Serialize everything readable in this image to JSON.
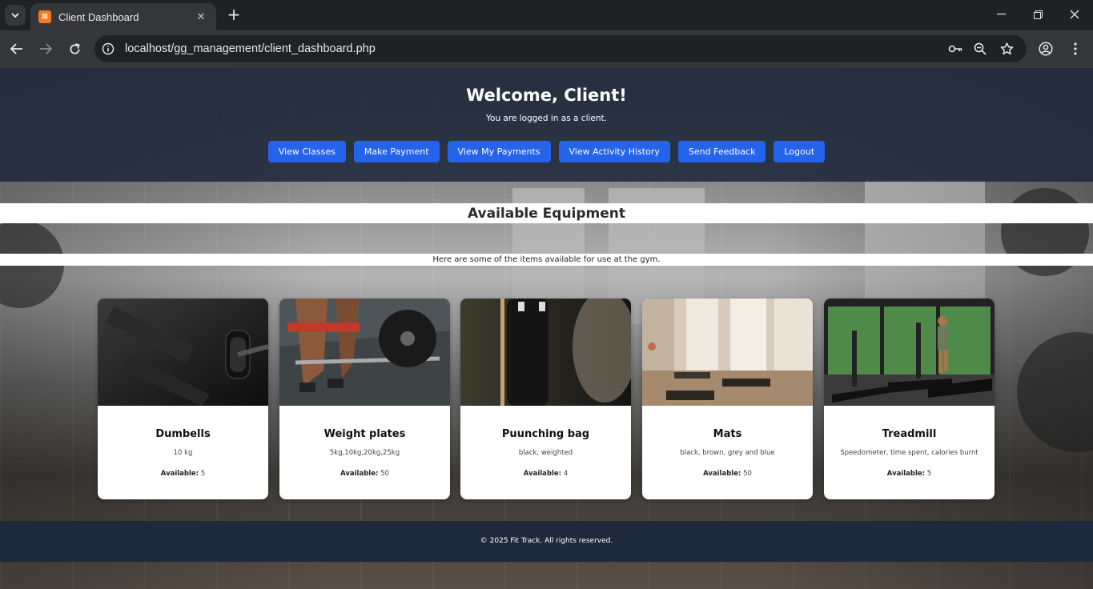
{
  "browser": {
    "tab_title": "Client Dashboard",
    "url": "localhost/gg_management/client_dashboard.php"
  },
  "header": {
    "title": "Welcome, Client!",
    "subtitle": "You are logged in as a client.",
    "nav": [
      "View Classes",
      "Make Payment",
      "View My Payments",
      "View Activity History",
      "Send Feedback",
      "Logout"
    ]
  },
  "equipment": {
    "title": "Available Equipment",
    "subtitle": "Here are some of the items available for use at the gym.",
    "available_label": "Available:",
    "items": [
      {
        "name": "Dumbells",
        "description": "10 kg",
        "available": "5"
      },
      {
        "name": "Weight plates",
        "description": "5kg,10kg,20kg,25kg",
        "available": "50"
      },
      {
        "name": "Puunching bag",
        "description": "black, weighted",
        "available": "4"
      },
      {
        "name": "Mats",
        "description": "black, brown, grey and blue",
        "available": "50"
      },
      {
        "name": "Treadmill",
        "description": "Speedometer, time spent, calories burnt",
        "available": "5"
      }
    ]
  },
  "footer": {
    "text": "© 2025 Fit Track. All rights reserved."
  },
  "colors": {
    "header_bg": "#1e293b",
    "button": "#2563eb",
    "footer_bg": "#1e293b"
  }
}
